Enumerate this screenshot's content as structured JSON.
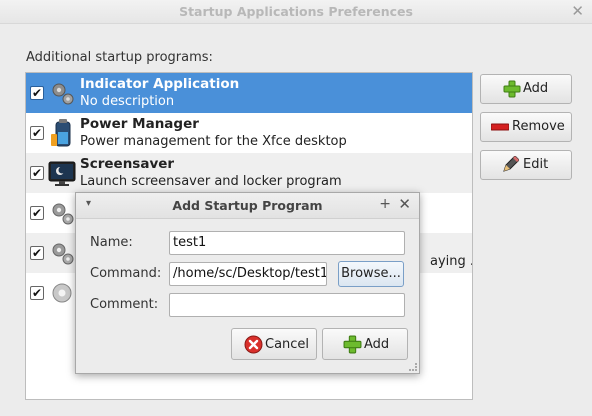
{
  "window": {
    "title": "Startup Applications Preferences",
    "close_glyph": "✕"
  },
  "list_label": "Additional startup programs:",
  "programs": [
    {
      "name": "Indicator Application",
      "description": "No description",
      "checked": true,
      "icon": "gears-icon",
      "selected": true
    },
    {
      "name": "Power Manager",
      "description": "Power management for the Xfce desktop",
      "checked": true,
      "icon": "battery-icon"
    },
    {
      "name": "Screensaver",
      "description": "Launch screensaver and locker program",
      "checked": true,
      "icon": "monitor-icon"
    },
    {
      "name": "",
      "description": "",
      "checked": true,
      "icon": "gears-icon"
    },
    {
      "name": "",
      "description": "aying ...",
      "checked": true,
      "icon": "gears-icon"
    },
    {
      "name": "",
      "description": "",
      "checked": true,
      "icon": "gear-icon"
    }
  ],
  "buttons": {
    "add": "Add",
    "remove": "Remove",
    "edit": "Edit"
  },
  "dialog": {
    "title": "Add Startup Program",
    "menu_glyph": "▾",
    "pin_glyph": "+",
    "close_glyph": "✕",
    "name_label": "Name:",
    "name_value": "test1",
    "command_label": "Command:",
    "command_value": "/home/sc/Desktop/test1",
    "browse_label": "Browse...",
    "comment_label": "Comment:",
    "comment_value": "",
    "cancel_label": "Cancel",
    "add_label": "Add"
  },
  "check_glyph": "✔",
  "colors": {
    "selection": "#4a90d9",
    "add_green": "#6dbb2e",
    "remove_red": "#d42020",
    "cancel_red": "#d9302b"
  }
}
